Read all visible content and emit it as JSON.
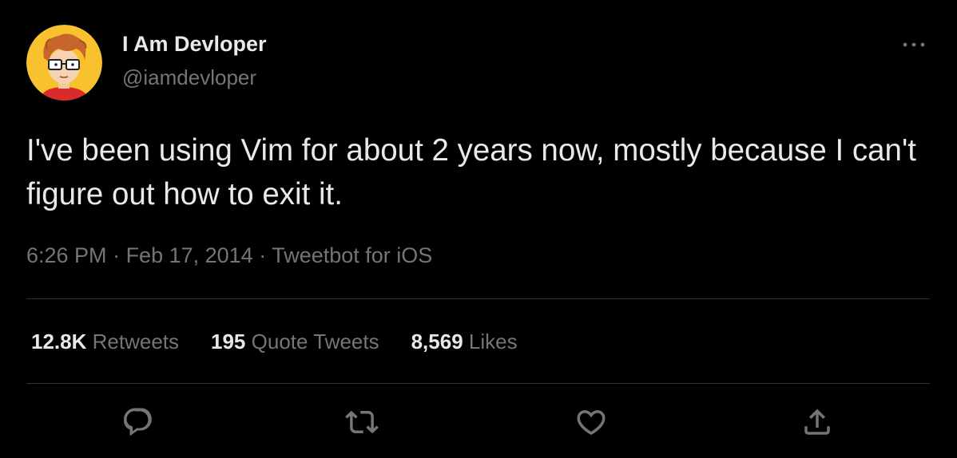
{
  "author": {
    "display_name": "I Am Devloper",
    "handle": "@iamdevloper",
    "avatar_icon": "cartoon-developer-avatar"
  },
  "tweet": {
    "text": "I've been using Vim for about 2 years now, mostly because I can't figure out how to exit it."
  },
  "meta": {
    "time": "6:26 PM",
    "separator": " · ",
    "date": "Feb 17, 2014",
    "source": "Tweetbot for iOS"
  },
  "stats": {
    "retweets": {
      "count": "12.8K",
      "label": "Retweets"
    },
    "quotes": {
      "count": "195",
      "label": "Quote Tweets"
    },
    "likes": {
      "count": "8,569",
      "label": "Likes"
    }
  },
  "actions": {
    "reply_icon": "reply-icon",
    "retweet_icon": "retweet-icon",
    "like_icon": "heart-icon",
    "share_icon": "share-icon",
    "more_icon": "more-icon"
  },
  "colors": {
    "background": "#000000",
    "primary_text": "#e7e9ea",
    "secondary_text": "#71767b",
    "divider": "#2f3336",
    "avatar_bg": "#f8c12d"
  }
}
